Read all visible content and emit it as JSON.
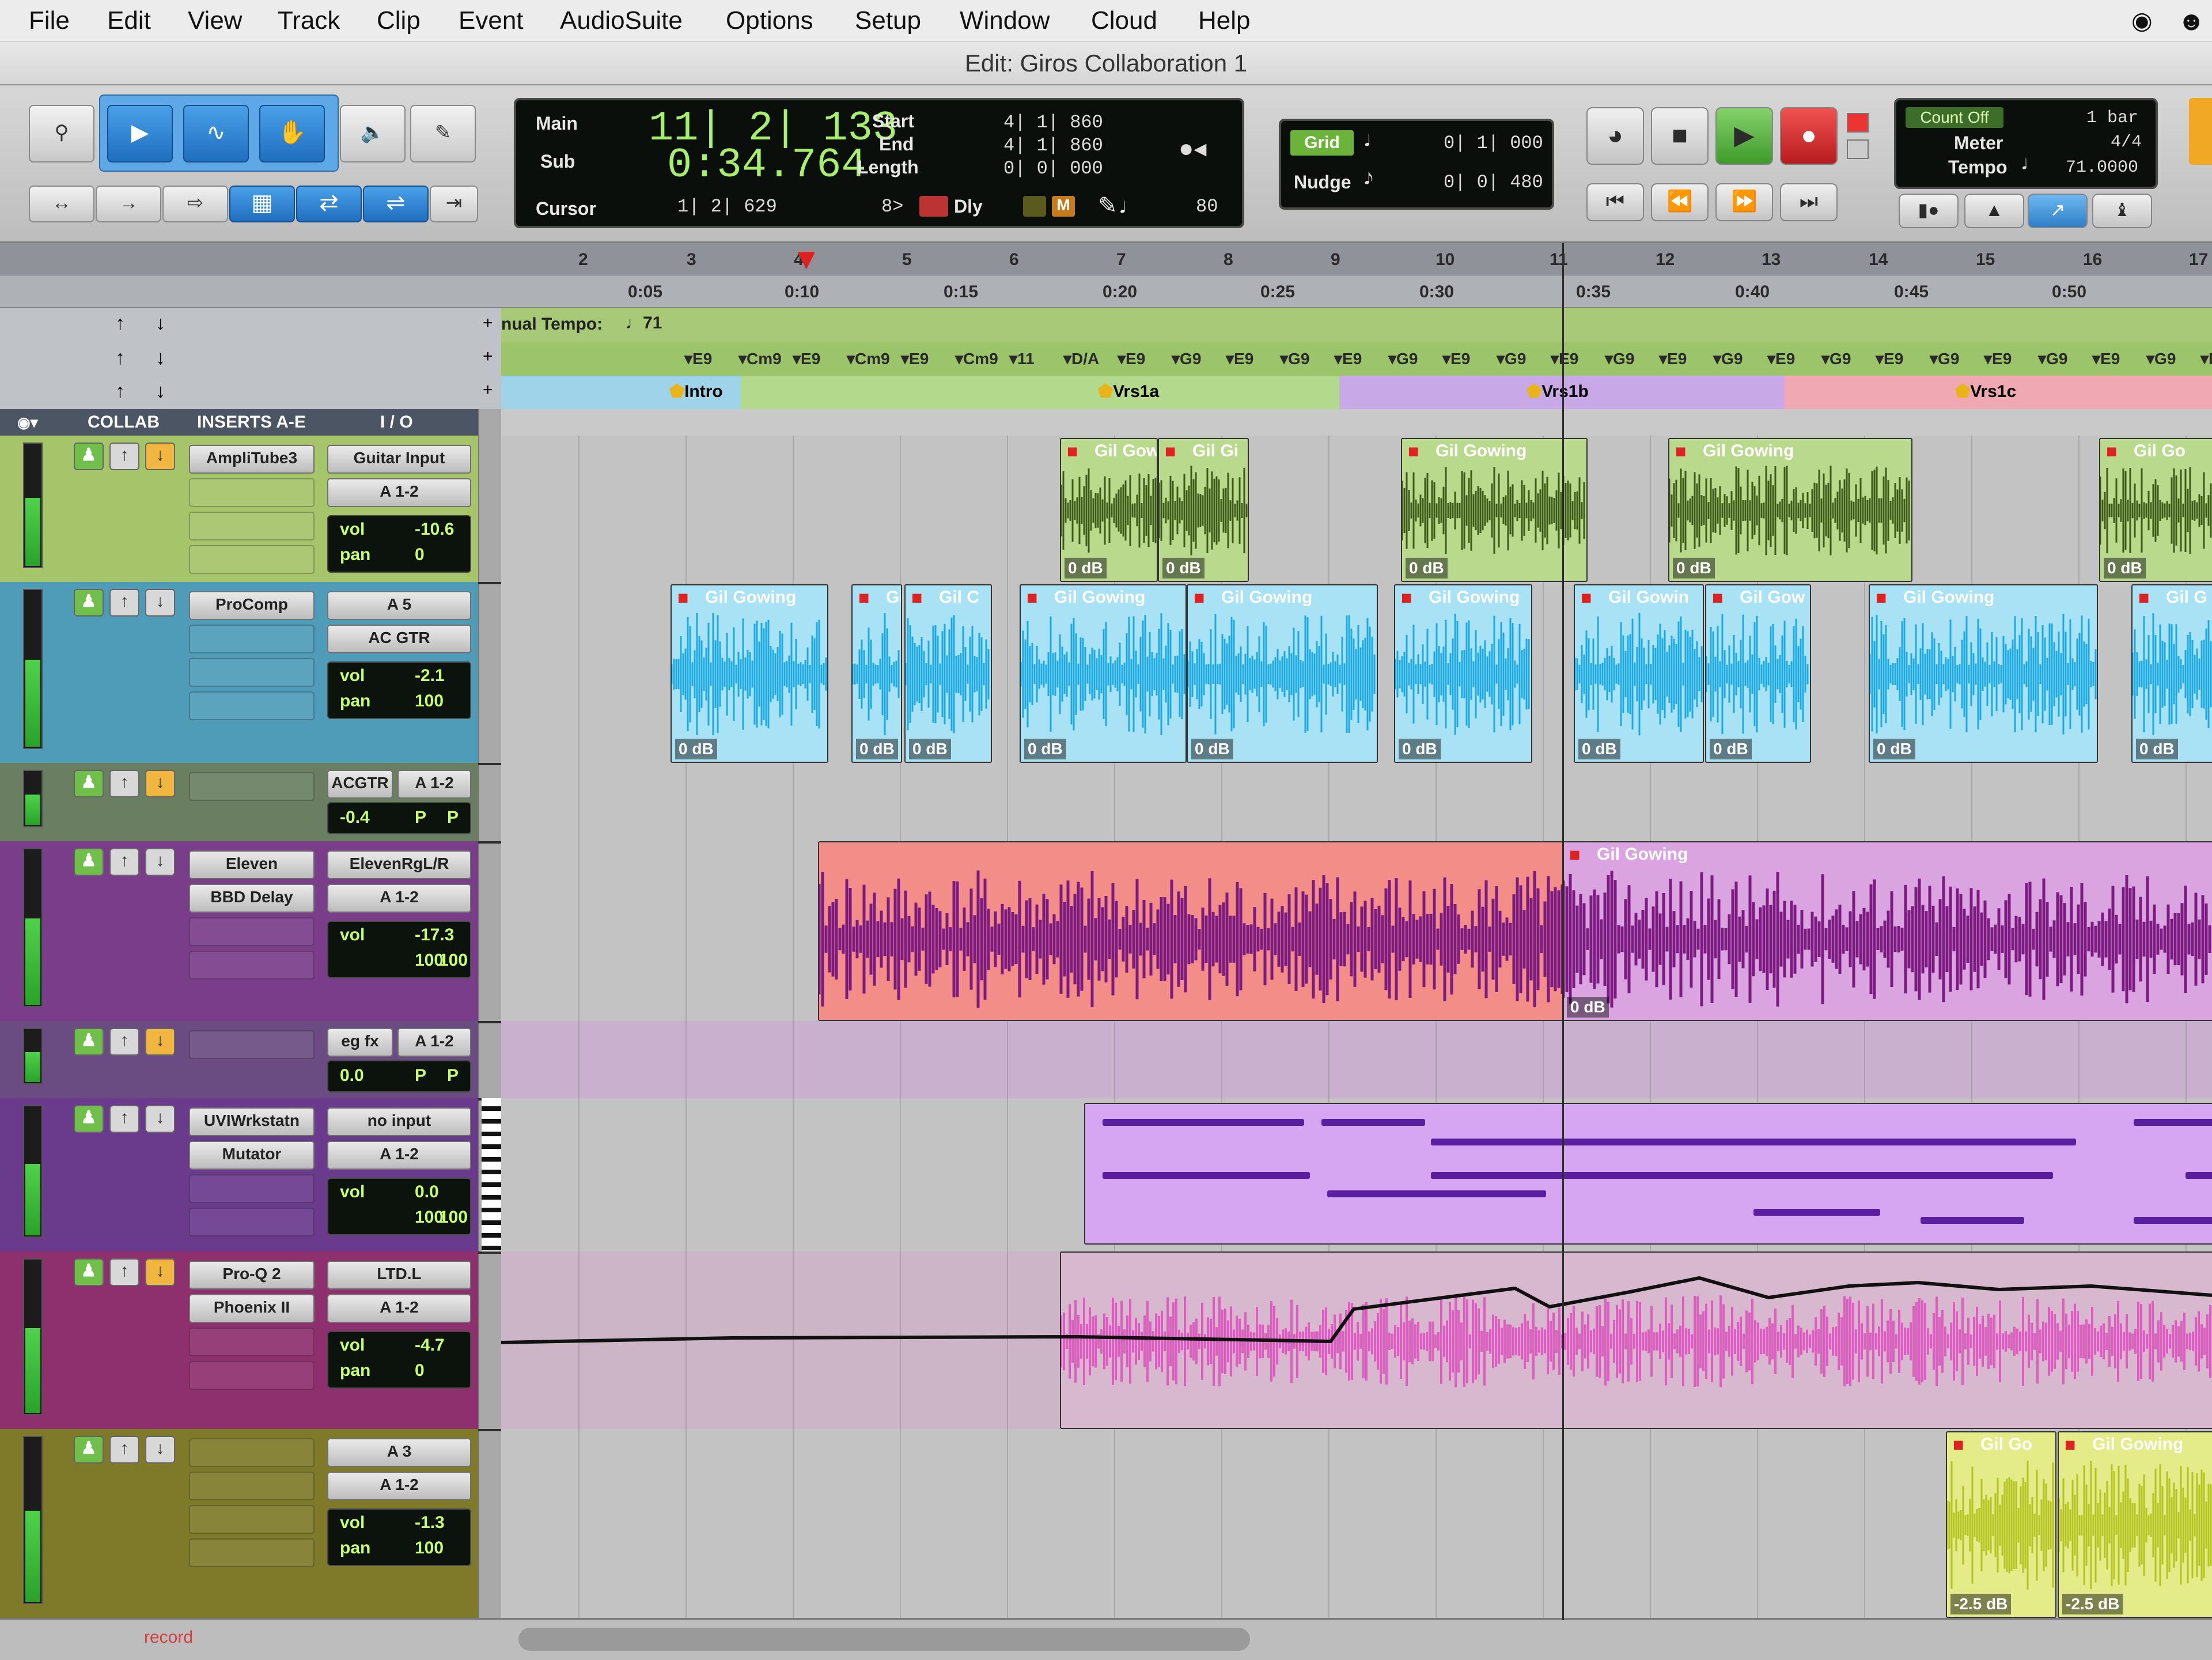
{
  "menu": {
    "items": [
      "File",
      "Edit",
      "View",
      "Track",
      "Clip",
      "Event",
      "AudioSuite",
      "Options",
      "Setup",
      "Window",
      "Cloud",
      "Help"
    ]
  },
  "window": {
    "title": "Edit: Giros Collaboration 1"
  },
  "counter": {
    "main_label": "Main",
    "main_value": "11| 2| 133",
    "sub_label": "Sub",
    "sub_value": "0:34.764",
    "start_label": "Start",
    "start_value": "4| 1| 860",
    "end_label": "End",
    "end_value": "4| 1| 860",
    "length_label": "Length",
    "length_value": "0| 0| 000",
    "cursor_label": "Cursor",
    "cursor_value": "1| 2| 629",
    "dly_label": "Dly",
    "tempo_small": "80",
    "preroll": "8>"
  },
  "grid": {
    "grid_label": "Grid",
    "grid_value": "0| 1| 000",
    "nudge_label": "Nudge",
    "nudge_value": "0| 0| 480"
  },
  "meter_panel": {
    "count_off": "Count Off",
    "count_off_value": "1 bar",
    "meter_label": "Meter",
    "meter_value": "4/4",
    "tempo_label": "Tempo",
    "tempo_value": "71.0000"
  },
  "rulers": {
    "bars": [
      "2",
      "3",
      "4",
      "5",
      "6",
      "7",
      "8",
      "9",
      "10",
      "11",
      "12",
      "13",
      "14",
      "15",
      "16",
      "17"
    ],
    "times": [
      "0:05",
      "0:10",
      "0:15",
      "0:20",
      "0:25",
      "0:30",
      "0:35",
      "0:40",
      "0:45",
      "0:50"
    ],
    "tempo_text": "nual Tempo:",
    "tempo_value": "♩71",
    "chords": [
      "E9",
      "Cm9",
      "E9",
      "Cm9",
      "E9",
      "Cm9",
      "11",
      "D/A",
      "E9",
      "G9",
      "E9",
      "G9",
      "E9",
      "G9",
      "E9",
      "G9",
      "E9",
      "G9",
      "E9",
      "G9",
      "E9",
      "G9",
      "E9",
      "G9",
      "E9",
      "G9",
      "E9",
      "G9",
      "E9"
    ],
    "markers": [
      "Intro",
      "Vrs1a",
      "Vrs1b",
      "Vrs1c"
    ]
  },
  "columns": {
    "collab": "COLLAB",
    "inserts": "INSERTS A-E",
    "io": "I / O"
  },
  "tracks": [
    {
      "insert1": "AmpliTube3",
      "io_in": "Guitar Input",
      "io_out": "A 1-2",
      "vol": "-10.6",
      "pan": "0",
      "vol_label": "vol",
      "pan_label": "pan",
      "color": "#a6c46a"
    },
    {
      "insert1": "ProComp",
      "io_in": "A 5",
      "io_out": "AC GTR",
      "vol": "-2.1",
      "pan": "100",
      "vol_label": "vol",
      "pan_label": "pan",
      "color": "#4f9cb8"
    },
    {
      "insert1": "",
      "io_in": "ACGTR",
      "io_out": "A 1-2",
      "vol": "-0.4",
      "pan": "P",
      "pan2": "P",
      "color": "#6a7f62"
    },
    {
      "insert1": "Eleven",
      "insert2": "BBD Delay",
      "io_in": "ElevenRgL/R",
      "io_out": "A 1-2",
      "vol": "-17.3",
      "pan": "100",
      "pan2": "100",
      "vol_label": "vol",
      "color": "#7a3d8a"
    },
    {
      "insert1": "",
      "io_in": "eg fx",
      "io_out": "A 1-2",
      "vol": "0.0",
      "pan": "P",
      "pan2": "P",
      "color": "#6b4c82"
    },
    {
      "insert1": "UVIWrkstatn",
      "insert2": "Mutator",
      "io_in": "no input",
      "io_out": "A 1-2",
      "vol": "0.0",
      "pan": "100",
      "pan2": "100",
      "vol_label": "vol",
      "color": "#6a3a8c"
    },
    {
      "insert1": "Pro-Q 2",
      "insert2": "Phoenix II",
      "io_in": "LTD.L",
      "io_out": "A 1-2",
      "vol": "-4.7",
      "pan": "0",
      "vol_label": "vol",
      "pan_label": "pan",
      "color": "#8e2f6e"
    },
    {
      "insert1": "",
      "io_in": "A 3",
      "io_out": "A 1-2",
      "vol": "-1.3",
      "pan": "100",
      "vol_label": "vol",
      "pan_label": "pan",
      "color": "#7e7a2a"
    }
  ],
  "clips": {
    "gil": "Gil Gowing",
    "gil_t1": "Gil Gowir",
    "gil_t2": "Gil Gi",
    "gil_t3": "Gil Go",
    "gil_t4": "Gil C",
    "gil_t5": "Gil Gowin",
    "gil_t6": "Gil Gow",
    "gil_t7": "Gil G",
    "db0": "0 dB",
    "db25": "-2.5 dB"
  },
  "status": {
    "record": "record"
  },
  "colors": {
    "green_clip": "#b9d98c",
    "green_wave": "#3d5a18",
    "blue_clip": "#a9e2f5",
    "blue_wave": "#1aa9e0",
    "red_clip": "#f28d87",
    "purple_clip": "#d9a4e0",
    "purple_wave": "#7c1a82",
    "midi_bg": "#d6a6f2",
    "midi_note": "#5a1ea0",
    "pink_wave": "#e05cc0",
    "yellow_clip": "#e4ec8a",
    "yellow_wave": "#b3c41e"
  }
}
